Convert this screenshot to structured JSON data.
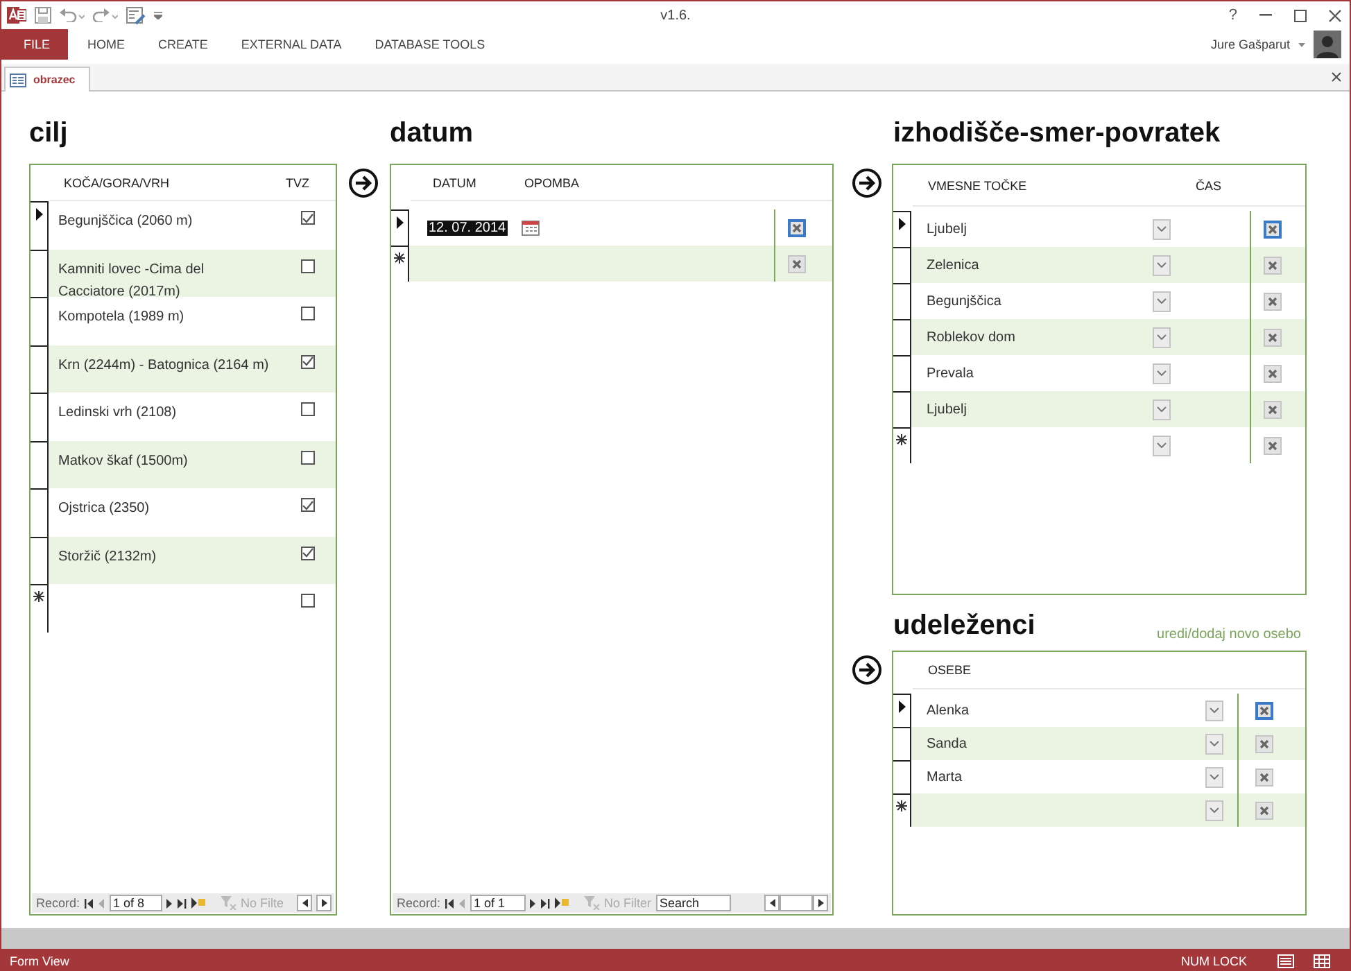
{
  "window": {
    "title": "v1.6.",
    "help": "?",
    "user": "Jure Gašparut"
  },
  "ribbon_tabs": [
    {
      "label": "FILE",
      "kind": "file"
    },
    {
      "label": "HOME",
      "kind": "tab"
    },
    {
      "label": "CREATE",
      "kind": "tab"
    },
    {
      "label": "EXTERNAL DATA",
      "kind": "tab"
    },
    {
      "label": "DATABASE TOOLS",
      "kind": "tab"
    }
  ],
  "document_tab": {
    "label": "obrazec"
  },
  "cilj": {
    "title": "cilj",
    "columns": [
      "KOČA/GORA/VRH",
      "TVZ"
    ],
    "rows": [
      {
        "kind": "record",
        "name": "Begunjščica (2060 m)",
        "tvz": true,
        "current": true
      },
      {
        "kind": "record",
        "name": "Kamniti lovec -Cima del Cacciatore (2017m)",
        "tvz": false,
        "current": false
      },
      {
        "kind": "record",
        "name": "Kompotela (1989 m)",
        "tvz": false,
        "current": false
      },
      {
        "kind": "record",
        "name": "Krn (2244m) - Batognica (2164 m)",
        "tvz": true,
        "current": false
      },
      {
        "kind": "record",
        "name": "Ledinski vrh (2108)",
        "tvz": false,
        "current": false
      },
      {
        "kind": "record",
        "name": "Matkov škaf (1500m)",
        "tvz": false,
        "current": false
      },
      {
        "kind": "record",
        "name": "Ojstrica (2350)",
        "tvz": true,
        "current": false
      },
      {
        "kind": "record",
        "name": "Storžič (2132m)",
        "tvz": true,
        "current": false
      },
      {
        "kind": "new",
        "tvz": false,
        "current": false
      }
    ],
    "navigator": {
      "label": "Record:",
      "position": "1 of 8",
      "filter": "No Filte"
    }
  },
  "datum": {
    "title": "datum",
    "columns": [
      "DATUM",
      "OPOMBA"
    ],
    "rows": [
      {
        "kind": "record",
        "date": "12. 07. 2014",
        "date_selected": true,
        "current": true
      },
      {
        "kind": "new",
        "current": false
      }
    ],
    "navigator": {
      "label": "Record:",
      "position": "1 of 1",
      "filter": "No Filter",
      "search_placeholder": "Search"
    }
  },
  "izhodisce": {
    "title": "izhodišče-smer-povratek",
    "columns": [
      "VMESNE TOČKE",
      "ČAS"
    ],
    "rows": [
      {
        "kind": "record",
        "name": "Ljubelj",
        "current": true
      },
      {
        "kind": "record",
        "name": "Zelenica",
        "current": false
      },
      {
        "kind": "record",
        "name": "Begunjščica",
        "current": false
      },
      {
        "kind": "record",
        "name": "Roblekov dom",
        "current": false
      },
      {
        "kind": "record",
        "name": "Prevala",
        "current": false
      },
      {
        "kind": "record",
        "name": "Ljubelj",
        "current": false
      },
      {
        "kind": "new",
        "current": false
      }
    ]
  },
  "udelezenci": {
    "title": "udeleženci",
    "link": "uredi/dodaj novo osebo",
    "columns": [
      "OSEBE"
    ],
    "rows": [
      {
        "kind": "record",
        "name": "Alenka",
        "current": true
      },
      {
        "kind": "record",
        "name": "Sanda",
        "current": false
      },
      {
        "kind": "record",
        "name": "Marta",
        "current": false
      },
      {
        "kind": "new",
        "current": false
      }
    ]
  },
  "status_bar": {
    "view": "Form View",
    "num_lock": "NUM LOCK"
  }
}
